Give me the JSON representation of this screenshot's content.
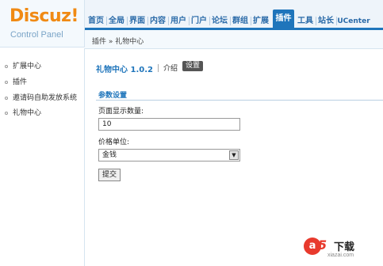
{
  "logo": {
    "brand": "Discuz!",
    "subtitle": "Control Panel"
  },
  "topnav": {
    "items": [
      "首页",
      "全局",
      "界面",
      "内容",
      "用户",
      "门户",
      "论坛",
      "群组",
      "扩展",
      "插件",
      "工具",
      "站长",
      "UCenter"
    ],
    "active_index": 9
  },
  "breadcrumb": "插件 » 礼物中心",
  "sidebar": {
    "items": [
      {
        "label": "扩展中心"
      },
      {
        "label": "插件"
      },
      {
        "label": "邀请码自助发放系统"
      },
      {
        "label": "礼物中心"
      }
    ]
  },
  "plugin": {
    "title": "礼物中心 1.0.2",
    "tab_intro": "介绍",
    "tab_settings": "设置"
  },
  "form": {
    "section_title": "参数设置",
    "page_count_label": "页面显示数量:",
    "page_count_value": "10",
    "price_unit_label": "价格单位:",
    "price_unit_value": "金钱",
    "submit_label": "提交"
  },
  "watermark": {
    "brand_letter": "a",
    "brand_digit": "5",
    "brand_text": "下载",
    "url": "xiazai.com"
  },
  "colors": {
    "accent": "#1f75bb",
    "logo": "#f08a14",
    "watermark": "#e83a2d"
  }
}
